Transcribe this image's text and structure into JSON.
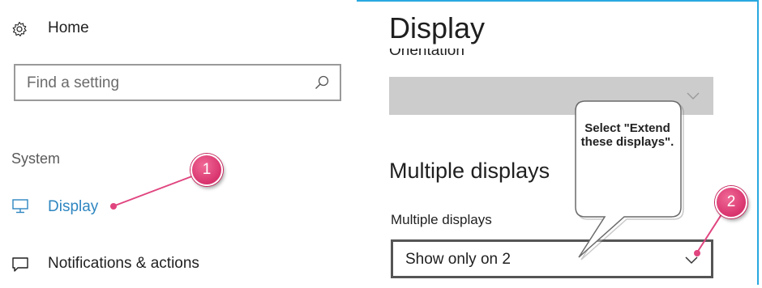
{
  "sidebar": {
    "home_label": "Home",
    "search": {
      "placeholder": "Find a setting"
    },
    "section_heading": "System",
    "items": [
      {
        "label": "Display",
        "icon": "monitor-icon",
        "selected": true
      },
      {
        "label": "Notifications & actions",
        "icon": "notifications-icon"
      }
    ]
  },
  "main": {
    "page_title": "Display",
    "orientation": {
      "label": "Orientation",
      "value": ""
    },
    "multiple_displays": {
      "heading": "Multiple displays",
      "label": "Multiple displays",
      "value": "Show only on 2"
    }
  },
  "annotations": {
    "badge_1": "1",
    "badge_2": "2",
    "callout": "Select \"Extend these displays\".",
    "accent_color": "#d8336d"
  },
  "colors": {
    "frame_border": "#29a8e0",
    "link_blue": "#2e86c1",
    "disabled_select": "#cccccc"
  }
}
